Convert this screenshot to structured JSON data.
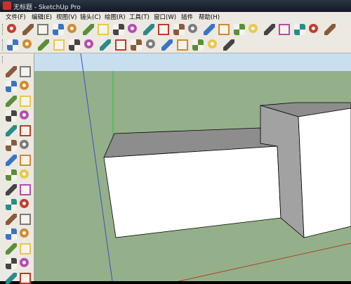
{
  "window": {
    "title": "无标题 - SketchUp Pro"
  },
  "menu": [
    "文件(F)",
    "编辑(E)",
    "视图(V)",
    "镜头(C)",
    "绘图(R)",
    "工具(T)",
    "窗口(W)",
    "插件",
    "帮助(H)"
  ],
  "toolbar_row1": [
    "select-icon",
    "pencil-icon",
    "rectangle-icon",
    "circle-icon",
    "arc-icon",
    "eraser-icon",
    "tape-measure-icon",
    "paint-bucket-icon",
    "push-pull-icon",
    "move-icon",
    "rotate-icon",
    "follow-me-icon",
    "orbit-icon",
    "zoom-icon",
    "zoom-extents-icon",
    "previous-view-icon",
    "iso-view-icon",
    "top-view-icon",
    "front-view-icon",
    "right-view-icon",
    "back-view-icon",
    "left-view-icon"
  ],
  "toolbar_row2": [
    "components-icon",
    "polygon-icon",
    "freehand-icon",
    "offset-icon",
    "section-icon",
    "text-icon",
    "dimension-icon",
    "protractor-icon",
    "axes-icon",
    "3d-text-icon",
    "walk-icon",
    "look-around-icon",
    "warehouse-icon",
    "share-model-icon",
    "extension-icon"
  ],
  "left_toolbar": [
    "select-icon",
    "component-icon",
    "paint-bucket-icon",
    "eraser-icon",
    "rectangle-icon",
    "line-icon",
    "circle-icon",
    "arc-icon",
    "move-icon",
    "push-pull-icon",
    "rotate-icon",
    "follow-me-icon",
    "scale-icon",
    "offset-icon",
    "tape-measure-icon",
    "dimension-icon",
    "protractor-icon",
    "text-icon",
    "axes-icon",
    "3d-text-icon",
    "orbit-icon",
    "pan-icon",
    "zoom-icon",
    "zoom-window-icon",
    "zoom-extents-icon",
    "previous-view-icon",
    "position-camera-icon",
    "look-around-icon",
    "walk-icon",
    "section-plane-icon"
  ],
  "colors": {
    "sky": "#c8dff0",
    "ground": "#94b08a",
    "face_front": "#ffffff",
    "face_shadow": "#a2a2a2",
    "face_top": "#8d8d8d",
    "edge": "#000000",
    "axis_blue": "#3b4fbf",
    "axis_green": "#21c43a",
    "axis_red": "#b0402a"
  }
}
